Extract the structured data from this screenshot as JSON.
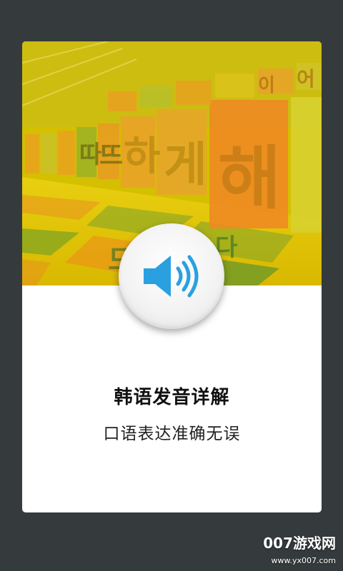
{
  "hero": {
    "image": "korean-letters-floor-photo",
    "tile_letters": [
      "하",
      "게",
      "해",
      "따",
      "뜨",
      "드",
      "다",
      "이",
      "어"
    ],
    "tint_color": "#d9c000"
  },
  "speaker_button": {
    "icon": "speaker-icon",
    "icon_color": "#2aa0e0"
  },
  "title": "韩语发音详解",
  "subtitle": "口语表达准确无误",
  "watermark": {
    "text": "007游戏网",
    "url": "www.yx007.com"
  }
}
